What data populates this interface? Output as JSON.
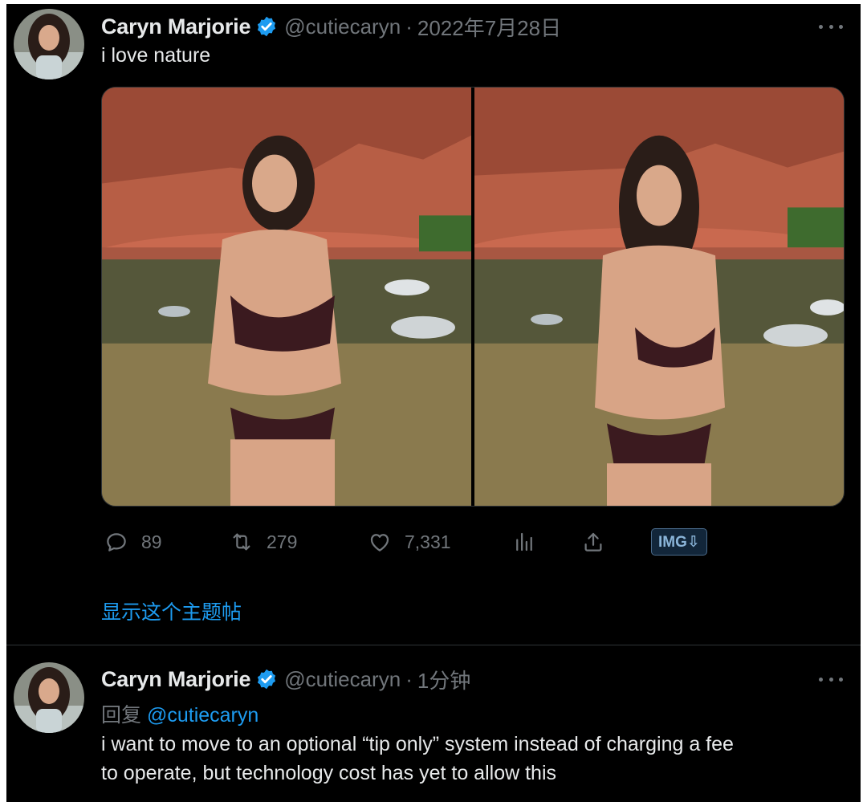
{
  "tweets": [
    {
      "author_name": "Caryn Marjorie",
      "handle": "@cutiecaryn",
      "separator": "·",
      "time": "2022年7月28日",
      "text": "i love nature",
      "media": [
        "photo",
        "photo"
      ],
      "stats": {
        "replies": "89",
        "retweets": "279",
        "likes": "7,331"
      },
      "img_download_label": "IMG⇩",
      "show_thread": "显示这个主题帖"
    },
    {
      "author_name": "Caryn Marjorie",
      "handle": "@cutiecaryn",
      "separator": "·",
      "time": "1分钟",
      "reply_prefix": "回复",
      "reply_to": "@cutiecaryn",
      "text_lines": [
        "i want to move to an optional “tip only” system instead of charging a fee",
        "to operate, but technology cost has yet to allow this"
      ]
    }
  ],
  "icons": [
    "verified-badge-icon",
    "more-icon",
    "reply-icon",
    "retweet-icon",
    "like-icon",
    "analytics-icon",
    "share-icon"
  ],
  "colors": {
    "background": "#000000",
    "text": "#e7e9ea",
    "muted": "#71767b",
    "accent": "#1d9bf0"
  }
}
